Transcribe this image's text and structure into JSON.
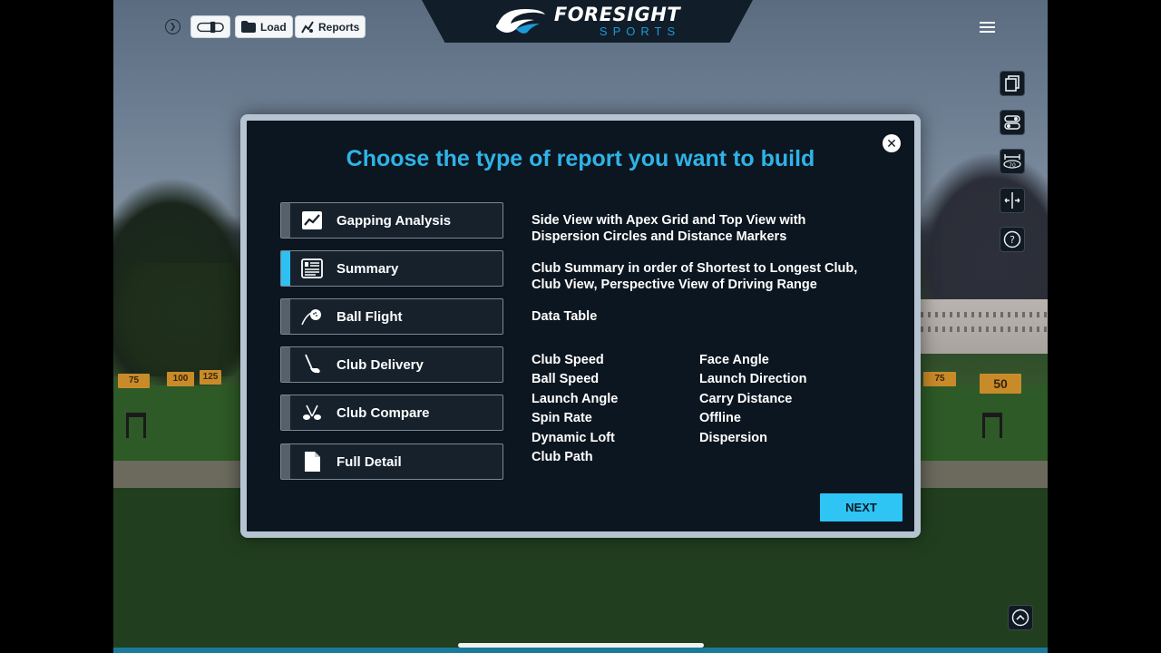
{
  "toolbar": {
    "load_label": "Load",
    "reports_label": "Reports"
  },
  "logo": {
    "brand": "FORESIGHT",
    "sub": "SPORTS"
  },
  "range_signs": [
    "75",
    "100",
    "125",
    "75",
    "50"
  ],
  "modal": {
    "title": "Choose the type of report you want to build",
    "options": [
      {
        "label": "Gapping Analysis",
        "active": false,
        "icon": "chart-icon"
      },
      {
        "label": "Summary",
        "active": true,
        "icon": "summary-icon"
      },
      {
        "label": "Ball Flight",
        "active": false,
        "icon": "ball-flight-icon"
      },
      {
        "label": "Club Delivery",
        "active": false,
        "icon": "club-icon"
      },
      {
        "label": "Club Compare",
        "active": false,
        "icon": "clubs-compare-icon"
      },
      {
        "label": "Full Detail",
        "active": false,
        "icon": "document-icon"
      }
    ],
    "descriptions": [
      "Side View with Apex Grid and Top View with Dispersion Circles and Distance Markers",
      "Club Summary in order of Shortest to Longest Club, Club View, Perspective View of Driving Range",
      "Data Table"
    ],
    "metrics_left": [
      "Club Speed",
      "Ball Speed",
      "Launch Angle",
      "Spin Rate",
      "Dynamic Loft",
      "Club Path"
    ],
    "metrics_right": [
      "Face Angle",
      "Launch Direction",
      "Carry Distance",
      "Offline",
      "Dispersion"
    ],
    "next_label": "NEXT"
  },
  "side_icons": [
    "copy-icon",
    "toggle-icon",
    "range-target-icon",
    "split-view-icon",
    "help-icon"
  ],
  "colors": {
    "accent": "#2ec4f3",
    "title": "#2fb3e6",
    "modal_bg": "#0c1620",
    "sign": "#c98b2a"
  }
}
